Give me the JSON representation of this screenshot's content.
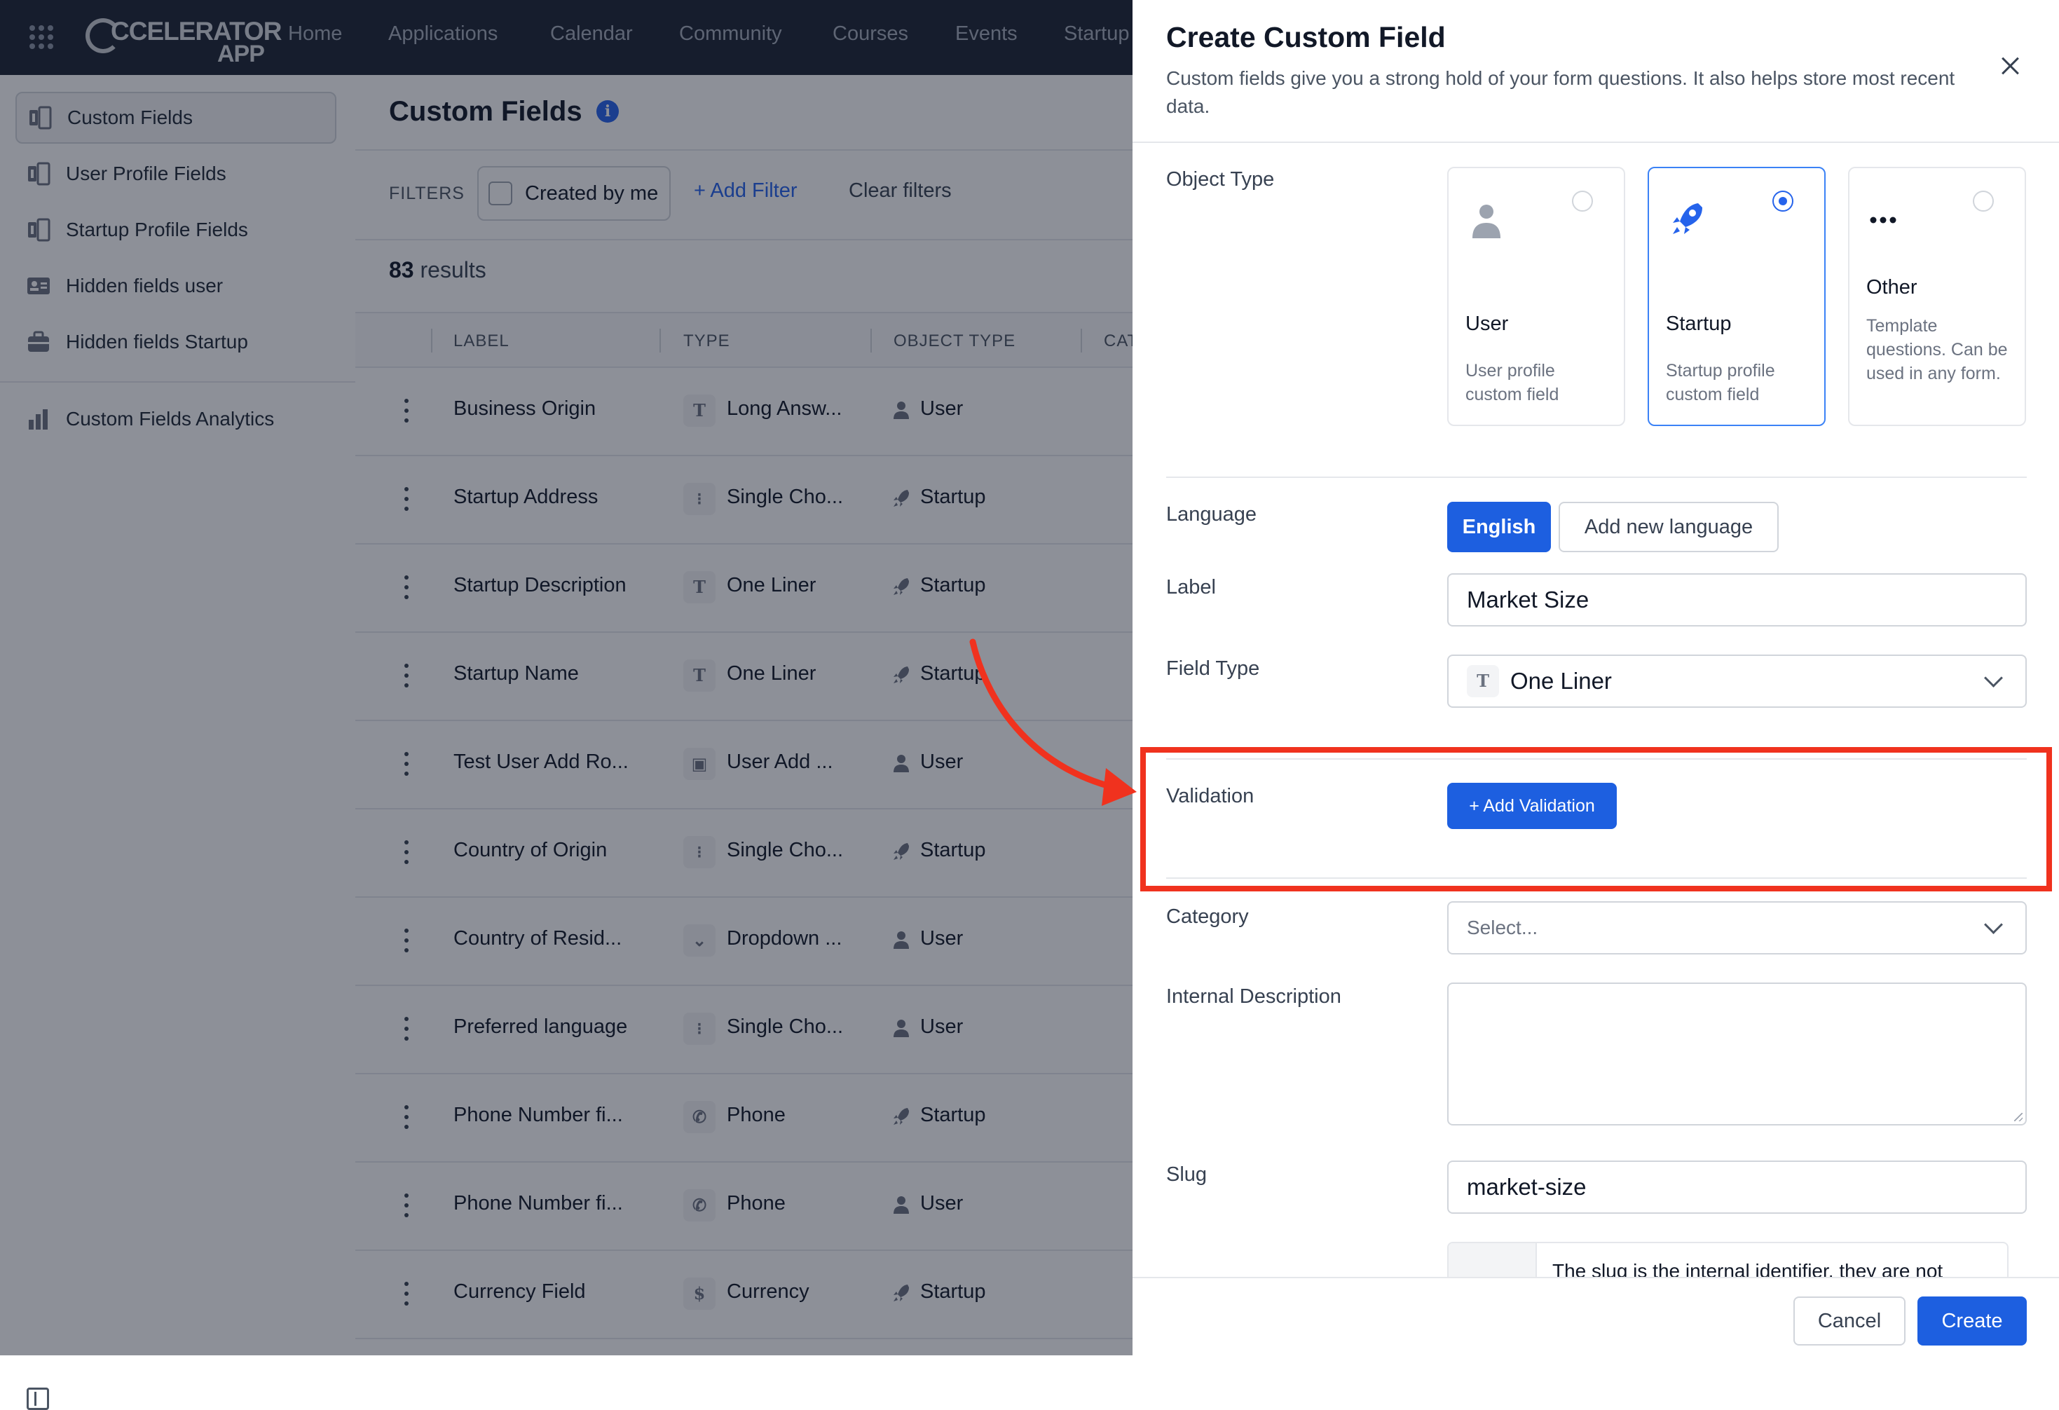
{
  "topnav": {
    "logo": {
      "word1": "CCELERATOR",
      "word2": "APP"
    },
    "items": [
      "Home",
      "Applications",
      "Calendar",
      "Community",
      "Courses",
      "Events",
      "Startup"
    ]
  },
  "sidebar": {
    "items": [
      {
        "label": "Custom Fields",
        "icon": "custom-field-icon",
        "active": true
      },
      {
        "label": "User Profile Fields",
        "icon": "custom-field-icon"
      },
      {
        "label": "Startup Profile Fields",
        "icon": "custom-field-icon"
      },
      {
        "label": "Hidden fields user",
        "icon": "id-card-icon"
      },
      {
        "label": "Hidden fields Startup",
        "icon": "briefcase-icon"
      },
      {
        "label": "Custom Fields Analytics",
        "icon": "bar-chart-icon"
      }
    ]
  },
  "main": {
    "title": "Custom Fields",
    "filters_label": "FILTERS",
    "created_by_me": "Created by me",
    "add_filter": "+ Add Filter",
    "clear_filters": "Clear filters",
    "results_count": "83",
    "results_suffix": " results",
    "columns": [
      "LABEL",
      "TYPE",
      "OBJECT TYPE",
      "CAT"
    ],
    "rows": [
      {
        "label": "Business Origin",
        "type": "Long Answ...",
        "type_icon": "T",
        "object": "User"
      },
      {
        "label": "Startup Address",
        "type": "Single Cho...",
        "type_icon": "⁝",
        "object": "Startup"
      },
      {
        "label": "Startup Description",
        "type": "One Liner",
        "type_icon": "T",
        "object": "Startup"
      },
      {
        "label": "Startup Name",
        "type": "One Liner",
        "type_icon": "T",
        "object": "Startup"
      },
      {
        "label": "Test User Add Ro...",
        "type": "User Add ...",
        "type_icon": "▣",
        "object": "User"
      },
      {
        "label": "Country of Origin",
        "type": "Single Cho...",
        "type_icon": "⁝",
        "object": "Startup"
      },
      {
        "label": "Country of Resid...",
        "type": "Dropdown ...",
        "type_icon": "⌄",
        "object": "User"
      },
      {
        "label": "Preferred language",
        "type": "Single Cho...",
        "type_icon": "⁝",
        "object": "User"
      },
      {
        "label": "Phone Number fi...",
        "type": "Phone",
        "type_icon": "✆",
        "object": "Startup"
      },
      {
        "label": "Phone Number fi...",
        "type": "Phone",
        "type_icon": "✆",
        "object": "User"
      },
      {
        "label": "Currency Field",
        "type": "Currency",
        "type_icon": "$",
        "object": "Startup"
      }
    ]
  },
  "drawer": {
    "title": "Create Custom Field",
    "subtitle": "Custom fields give you a strong hold of your form questions. It also helps store most recent data.",
    "object_type_label": "Object Type",
    "object_types": [
      {
        "title": "User",
        "desc": "User profile custom field",
        "selected": false,
        "icon": "user-icon"
      },
      {
        "title": "Startup",
        "desc": "Startup profile custom field",
        "selected": true,
        "icon": "rocket-icon"
      },
      {
        "title": "Other",
        "desc": "Template questions. Can be used in any form.",
        "selected": false,
        "icon": "dots-icon"
      }
    ],
    "language_label": "Language",
    "language_current": "English",
    "language_add": "Add new language",
    "label_label": "Label",
    "label_value": "Market Size",
    "field_type_label": "Field Type",
    "field_type_icon": "T",
    "field_type_value": "One Liner",
    "validation_label": "Validation",
    "add_validation": "+ Add Validation",
    "category_label": "Category",
    "category_placeholder": "Select...",
    "internal_description_label": "Internal Description",
    "internal_description_value": "",
    "slug_label": "Slug",
    "slug_value": "market-size",
    "slug_note": "The slug is the internal identifier, they are not",
    "cancel": "Cancel",
    "create": "Create"
  },
  "colors": {
    "topbar": "#1b2433",
    "primary": "#1d5fe0",
    "annotation": "#f0321e"
  }
}
